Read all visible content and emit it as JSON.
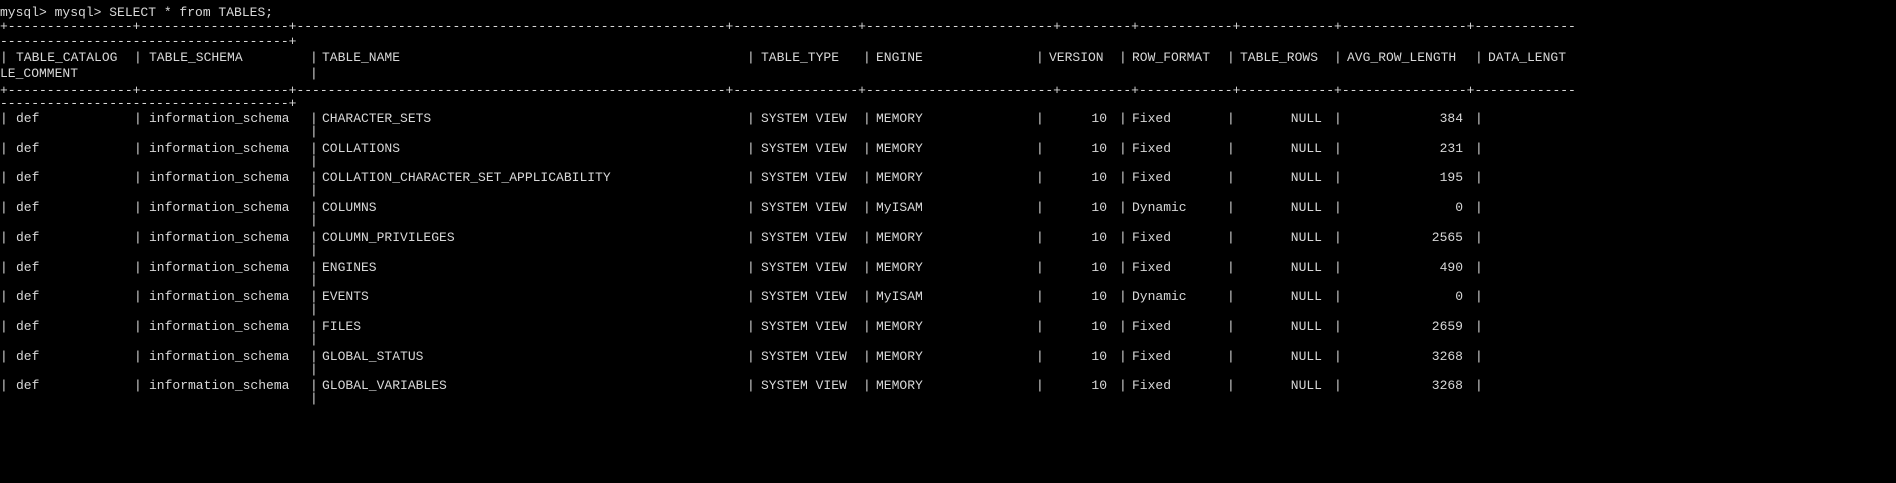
{
  "terminal": {
    "background": "#000000",
    "text_color": "#d8d8d8",
    "prompt_line": "mysql> mysql> SELECT * from TABLES;",
    "border_top": "+----------------+-------------------+-------------------------------------------------------+----------------+------------------------+---------+------------+------------+----------------+-------------",
    "border_top_wrap": "-------------------------------------+",
    "border_header": "+----------------+-------------------+-------------------------------------------------------+----------------+------------------------+---------+------------+------------+----------------+-------------",
    "border_header_wrap": "-------------------------------------+",
    "header": {
      "table_catalog": "TABLE_CATALOG",
      "table_schema": "TABLE_SCHEMA",
      "table_name": "TABLE_NAME",
      "table_type": "TABLE_TYPE",
      "engine": "ENGINE",
      "version": "VERSION",
      "row_format": "ROW_FORMAT",
      "table_rows": "TABLE_ROWS",
      "avg_row_length": "AVG_ROW_LENGTH",
      "data_length": "DATA_LENGT",
      "wrap": "LE_COMMENT"
    },
    "rows": [
      {
        "table_catalog": "def",
        "table_schema": "information_schema",
        "table_name": "CHARACTER_SETS",
        "table_type": "SYSTEM VIEW",
        "engine": "MEMORY",
        "version": "10",
        "row_format": "Fixed",
        "table_rows": "NULL",
        "avg_row_length": "384"
      },
      {
        "table_catalog": "def",
        "table_schema": "information_schema",
        "table_name": "COLLATIONS",
        "table_type": "SYSTEM VIEW",
        "engine": "MEMORY",
        "version": "10",
        "row_format": "Fixed",
        "table_rows": "NULL",
        "avg_row_length": "231"
      },
      {
        "table_catalog": "def",
        "table_schema": "information_schema",
        "table_name": "COLLATION_CHARACTER_SET_APPLICABILITY",
        "table_type": "SYSTEM VIEW",
        "engine": "MEMORY",
        "version": "10",
        "row_format": "Fixed",
        "table_rows": "NULL",
        "avg_row_length": "195"
      },
      {
        "table_catalog": "def",
        "table_schema": "information_schema",
        "table_name": "COLUMNS",
        "table_type": "SYSTEM VIEW",
        "engine": "MyISAM",
        "version": "10",
        "row_format": "Dynamic",
        "table_rows": "NULL",
        "avg_row_length": "0"
      },
      {
        "table_catalog": "def",
        "table_schema": "information_schema",
        "table_name": "COLUMN_PRIVILEGES",
        "table_type": "SYSTEM VIEW",
        "engine": "MEMORY",
        "version": "10",
        "row_format": "Fixed",
        "table_rows": "NULL",
        "avg_row_length": "2565"
      },
      {
        "table_catalog": "def",
        "table_schema": "information_schema",
        "table_name": "ENGINES",
        "table_type": "SYSTEM VIEW",
        "engine": "MEMORY",
        "version": "10",
        "row_format": "Fixed",
        "table_rows": "NULL",
        "avg_row_length": "490"
      },
      {
        "table_catalog": "def",
        "table_schema": "information_schema",
        "table_name": "EVENTS",
        "table_type": "SYSTEM VIEW",
        "engine": "MyISAM",
        "version": "10",
        "row_format": "Dynamic",
        "table_rows": "NULL",
        "avg_row_length": "0"
      },
      {
        "table_catalog": "def",
        "table_schema": "information_schema",
        "table_name": "FILES",
        "table_type": "SYSTEM VIEW",
        "engine": "MEMORY",
        "version": "10",
        "row_format": "Fixed",
        "table_rows": "NULL",
        "avg_row_length": "2659"
      },
      {
        "table_catalog": "def",
        "table_schema": "information_schema",
        "table_name": "GLOBAL_STATUS",
        "table_type": "SYSTEM VIEW",
        "engine": "MEMORY",
        "version": "10",
        "row_format": "Fixed",
        "table_rows": "NULL",
        "avg_row_length": "3268"
      },
      {
        "table_catalog": "def",
        "table_schema": "information_schema",
        "table_name": "GLOBAL_VARIABLES",
        "table_type": "SYSTEM VIEW",
        "engine": "MEMORY",
        "version": "10",
        "row_format": "Fixed",
        "table_rows": "NULL",
        "avg_row_length": "3268"
      }
    ],
    "wrap_bar": "|"
  }
}
